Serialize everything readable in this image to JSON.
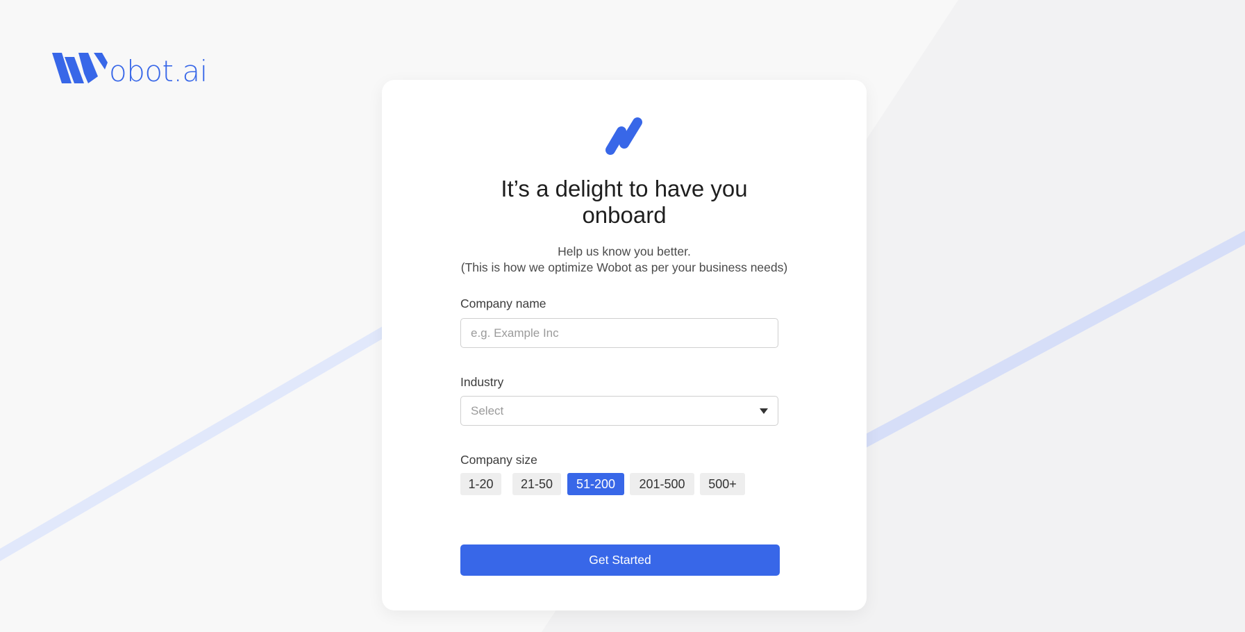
{
  "brand": {
    "wordmark": "obot.ai"
  },
  "onboarding": {
    "headline_line1": "It’s a delight to have you",
    "headline_line2": "onboard",
    "subtext_line1": "Help us know you better.",
    "subtext_line2": "(This is how we optimize Wobot as per your business needs)"
  },
  "form": {
    "company_name": {
      "label": "Company name",
      "value": "",
      "placeholder": "e.g. Example Inc"
    },
    "industry": {
      "label": "Industry",
      "selected": "Select"
    },
    "company_size": {
      "label": "Company size",
      "options": [
        "1-20",
        "21-50",
        "51-200",
        "201-500",
        "500+"
      ],
      "selected": "51-200"
    },
    "submit_label": "Get Started"
  },
  "colors": {
    "accent": "#3867e8",
    "background": "#f2f2f3",
    "card": "#ffffff",
    "chip_bg": "#eeeeee",
    "stripe": "#dfe6fb"
  },
  "icons": {
    "brand_logo": "wobot-w-logo-icon",
    "card_logo": "wobot-mark-icon",
    "dropdown": "caret-down-icon"
  }
}
